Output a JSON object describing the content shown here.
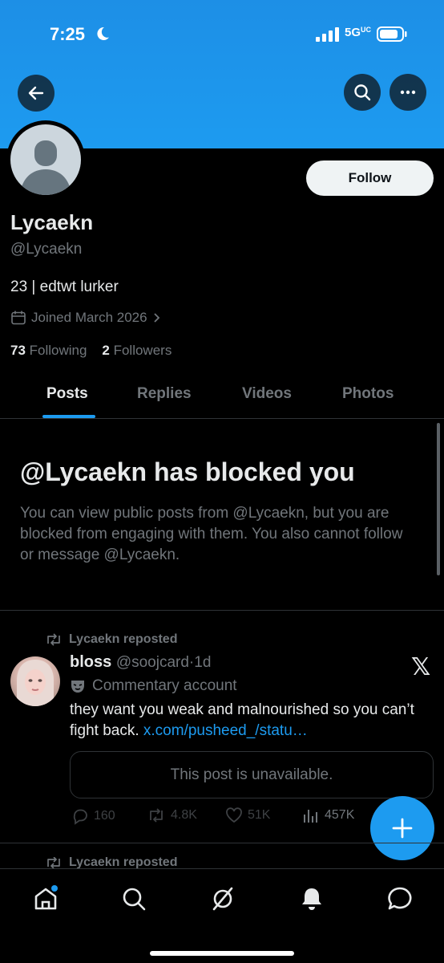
{
  "status_bar": {
    "time": "7:25",
    "network": "5G",
    "network_suffix": "UC"
  },
  "profile": {
    "name": "Lycaekn",
    "handle": "@Lycaekn",
    "bio": "23 | edtwt lurker",
    "joined": "Joined March 2026",
    "following_count": "73",
    "following_label": "Following",
    "followers_count": "2",
    "followers_label": "Followers",
    "follow_button": "Follow"
  },
  "tabs": [
    "Posts",
    "Replies",
    "Videos",
    "Photos"
  ],
  "active_tab": "Posts",
  "blocked": {
    "title": "@Lycaekn has blocked you",
    "message": "You can view public posts from @Lycaekn, but you are blocked from engaging with them. You also cannot follow or message @Lycaekn."
  },
  "post": {
    "repost_label": "Lycaekn reposted",
    "author_name": "bloss",
    "author_handle": "@soojcard",
    "age": "1d",
    "label": "Commentary account",
    "text": "they want you weak and malnourished so you can’t fight back. ",
    "link": "x.com/pusheed_/statu…",
    "unavailable": "This post is unavailable.",
    "replies": "160",
    "reposts": "4.8K",
    "likes": "51K",
    "views": "457K"
  },
  "next_post": {
    "repost_label": "Lycaekn reposted"
  },
  "colors": {
    "accent": "#1d9bf0",
    "banner": "#1d9bf0",
    "muted": "#71767b",
    "text": "#e7e9ea"
  },
  "icons": [
    "back-arrow-icon",
    "search-icon",
    "more-icon",
    "calendar-icon",
    "chevron-right-icon",
    "repost-icon",
    "x-logo-icon",
    "mask-icon",
    "reply-icon",
    "like-icon",
    "views-icon",
    "compose-plus-icon",
    "home-icon",
    "grok-icon",
    "bell-icon",
    "messages-icon"
  ]
}
